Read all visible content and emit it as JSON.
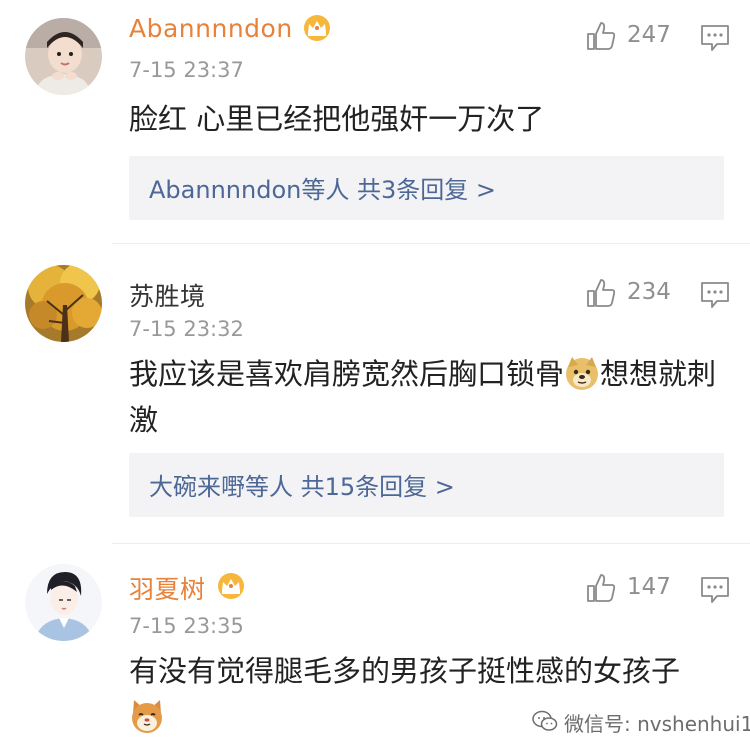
{
  "comments": [
    {
      "username": "Abannnndon",
      "vip": true,
      "time": "7-15 23:37",
      "likes": "247",
      "text": "脸红 心里已经把他强奸一万次了",
      "replies": "Abannnndon等人  共3条回复 >"
    },
    {
      "username": "苏胜境",
      "vip": false,
      "time": "7-15 23:32",
      "likes": "234",
      "text_before_emoji": "我应该是喜欢肩膀宽然后胸口锁骨",
      "text_after_emoji": "想想就刺激",
      "replies": "大碗来嘢等人  共15条回复 >"
    },
    {
      "username": "羽夏树",
      "vip": true,
      "time": "7-15 23:35",
      "likes": "147",
      "text": "有没有觉得腿毛多的男孩子挺性感的女孩子"
    }
  ],
  "watermark": "微信号: nvshenhui1",
  "colors": {
    "vip_name": "#e8813a",
    "reply_link": "#4d6896",
    "reply_bg": "#f3f3f5",
    "meta_gray": "#999999"
  },
  "icons": [
    "crown-icon",
    "thumbs-up-icon",
    "reply-comment-icon",
    "doge-emoji",
    "cat-emoji",
    "wechat-icon"
  ]
}
